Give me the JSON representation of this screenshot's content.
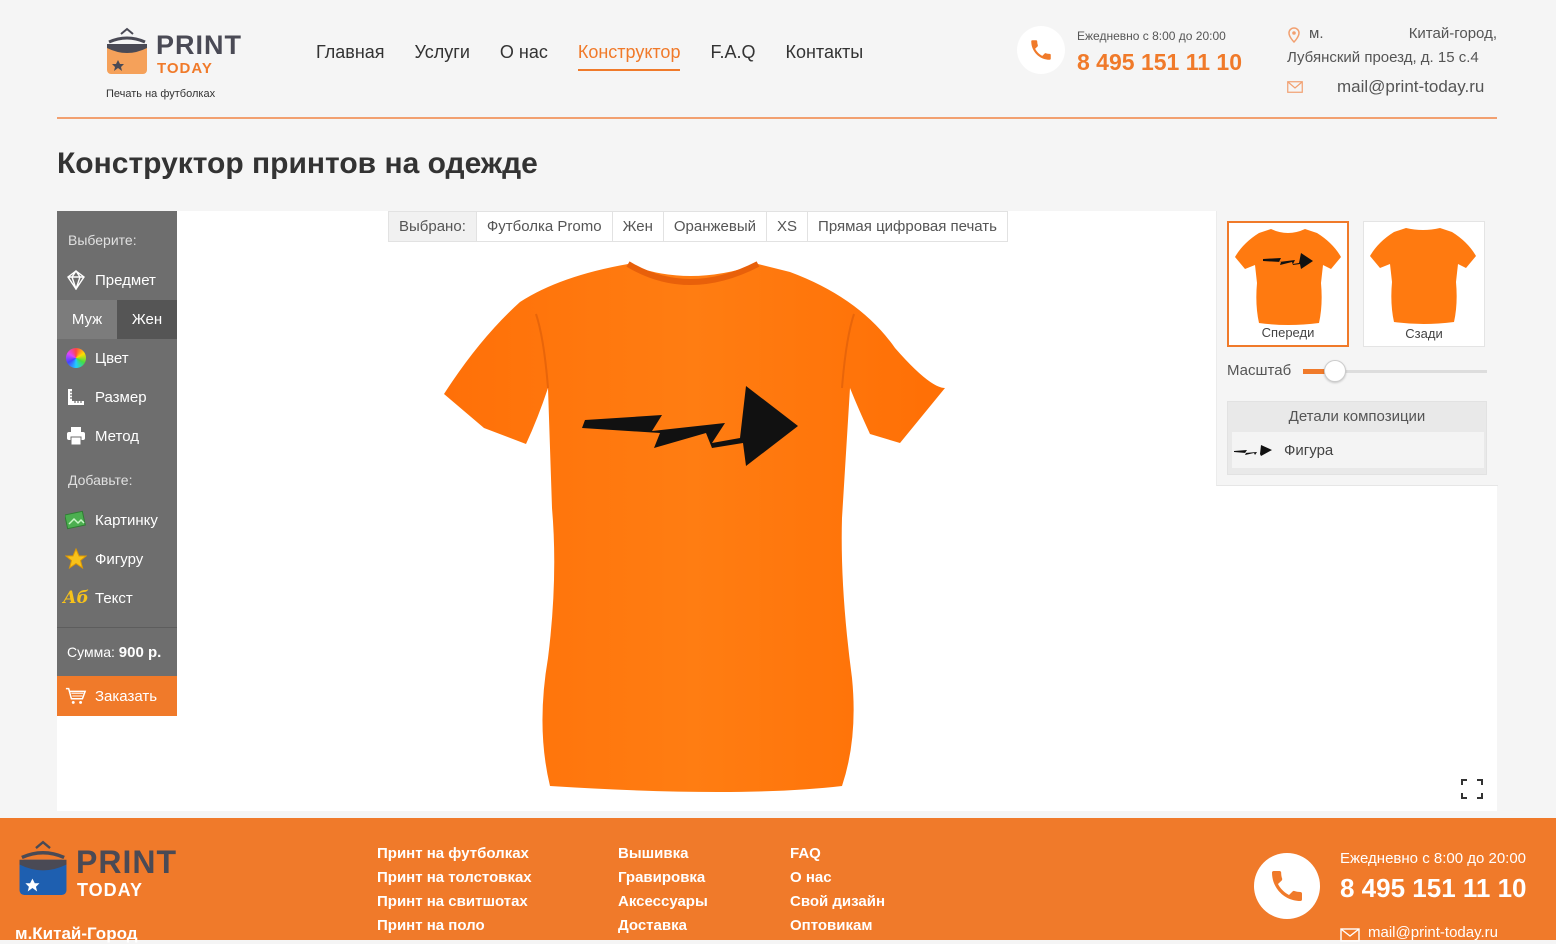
{
  "colors": {
    "accent": "#f07a2a",
    "dark": "#4a4a55",
    "sidebar": "#6e6e6e"
  },
  "header": {
    "logo_print": "PRINT",
    "logo_today": "TODAY",
    "logo_tagline": "Печать на футболках",
    "nav": [
      {
        "label": "Главная",
        "active": false
      },
      {
        "label": "Услуги",
        "active": false
      },
      {
        "label": "О нас",
        "active": false
      },
      {
        "label": "Конструктор",
        "active": true
      },
      {
        "label": "F.A.Q",
        "active": false
      },
      {
        "label": "Контакты",
        "active": false
      }
    ],
    "hours": "Ежедневно с 8:00 до 20:00",
    "phone": "8 495 151 11 10",
    "address_line1": "м. Китай-город,",
    "address_line2": "Лубянский проезд, д. 15 с.4",
    "email": "mail@print-today.ru",
    "icons": {
      "phone": "phone-icon",
      "address": "map-pin-icon",
      "email": "mail-icon"
    }
  },
  "page": {
    "title": "Конструктор принтов на одежде"
  },
  "sidebar": {
    "choose_label": "Выберите:",
    "item_label": "Предмет",
    "gender_male": "Муж",
    "gender_female": "Жен",
    "gender_selected": "Жен",
    "color_label": "Цвет",
    "size_label": "Размер",
    "method_label": "Метод",
    "add_label": "Добавьте:",
    "image_label": "Картинку",
    "shape_label": "Фигуру",
    "text_label": "Текст",
    "sum_label": "Сумма:",
    "sum_value": "900 р.",
    "order_label": "Заказать"
  },
  "selection": {
    "label": "Выбрано:",
    "product": "Футболка Promo",
    "gender": "Жен",
    "color": "Оранжевый",
    "size": "XS",
    "method": "Прямая цифровая печать"
  },
  "canvas": {
    "product_color": "#ff7a10",
    "print": "lightning-arrow"
  },
  "panel": {
    "front_label": "Спереди",
    "back_label": "Сзади",
    "selected_view": "Спереди",
    "scale_label": "Масштаб",
    "scale_level": 0.17,
    "details_title": "Детали композиции",
    "detail_item": "Фигура"
  },
  "footer": {
    "logo_print": "PRINT",
    "logo_today": "TODAY",
    "metro": "м.Китай-Город",
    "col1": [
      "Принт на футболках",
      "Принт на толстовках",
      "Принт на свитшотах",
      "Принт на поло"
    ],
    "col2": [
      "Вышивка",
      "Гравировка",
      "Аксессуары",
      "Доставка"
    ],
    "col3": [
      "FAQ",
      "О нас",
      "Свой дизайн",
      "Оптовикам"
    ],
    "hours": "Ежедневно с 8:00 до 20:00",
    "phone": "8 495 151 11 10",
    "email": "mail@print-today.ru"
  }
}
